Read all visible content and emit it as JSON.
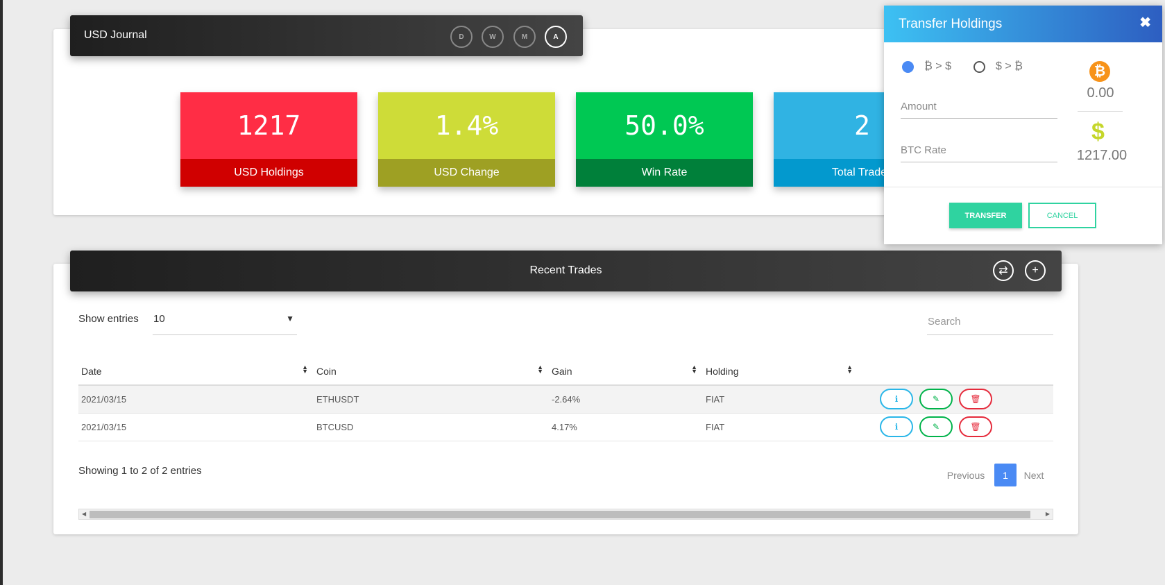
{
  "journal": {
    "title": "USD Journal",
    "periods": [
      "D",
      "W",
      "M",
      "A"
    ],
    "active_period": "A"
  },
  "stats": [
    {
      "value": "1217",
      "label": "USD Holdings",
      "top_color": "#ff2d45",
      "bottom_color": "#d00000"
    },
    {
      "value": "1.4%",
      "label": "USD Change",
      "top_color": "#cedc38",
      "bottom_color": "#9ea023"
    },
    {
      "value": "50.0%",
      "label": "Win Rate",
      "top_color": "#00c853",
      "bottom_color": "#00803a"
    },
    {
      "value": "2",
      "label": "Total Trades",
      "top_color": "#30b3e3",
      "bottom_color": "#0399ce"
    }
  ],
  "trades": {
    "title": "Recent Trades",
    "show_entries_label": "Show entries",
    "entries_value": "10",
    "search_placeholder": "Search",
    "columns": [
      "Date",
      "Coin",
      "Gain",
      "Holding"
    ],
    "rows": [
      {
        "date": "2021/03/15",
        "coin": "ETHUSDT",
        "gain": "-2.64%",
        "holding": "FIAT"
      },
      {
        "date": "2021/03/15",
        "coin": "BTCUSD",
        "gain": "4.17%",
        "holding": "FIAT"
      }
    ],
    "info_text": "Showing 1 to 2 of 2 entries",
    "pagination": {
      "previous": "Previous",
      "current": "1",
      "next": "Next"
    }
  },
  "transfer_modal": {
    "title": "Transfer Holdings",
    "close": "✖",
    "option_btc_to_usd": "₿ > $",
    "option_usd_to_btc": "$ > ₿",
    "selected_option": "₿ > $",
    "amount_placeholder": "Amount",
    "rate_placeholder": "BTC Rate",
    "btc_symbol": "₿",
    "btc_value": "0.00",
    "usd_symbol": "$",
    "usd_value": "1217.00",
    "transfer_label": "TRANSFER",
    "cancel_label": "CANCEL"
  }
}
